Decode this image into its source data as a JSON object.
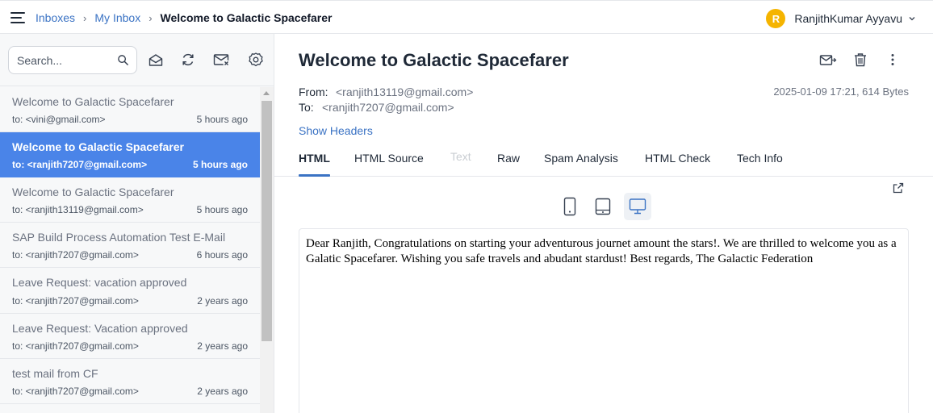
{
  "breadcrumb": {
    "items": [
      "Inboxes",
      "My Inbox"
    ],
    "current": "Welcome to Galactic Spacefarer"
  },
  "user": {
    "initial": "R",
    "name": "RanjithKumar Ayyavu",
    "avatar_color": "#f5b400"
  },
  "search": {
    "placeholder": "Search..."
  },
  "toolbar_icons": [
    "mark-read-icon",
    "refresh-icon",
    "clear-inbox-icon",
    "settings-icon"
  ],
  "messages": [
    {
      "subject": "Welcome to Galactic Spacefarer",
      "to": "to: <vini@gmail.com>",
      "time": "5 hours ago",
      "active": false
    },
    {
      "subject": "Welcome to Galactic Spacefarer",
      "to": "to: <ranjith7207@gmail.com>",
      "time": "5 hours ago",
      "active": true
    },
    {
      "subject": "Welcome to Galactic Spacefarer",
      "to": "to: <ranjith13119@gmail.com>",
      "time": "5 hours ago",
      "active": false
    },
    {
      "subject": "SAP Build Process Automation Test E-Mail",
      "to": "to: <ranjith7207@gmail.com>",
      "time": "6 hours ago",
      "active": false
    },
    {
      "subject": "Leave Request: vacation approved",
      "to": "to: <ranjith7207@gmail.com>",
      "time": "2 years ago",
      "active": false
    },
    {
      "subject": "Leave Request: Vacation approved",
      "to": "to: <ranjith7207@gmail.com>",
      "time": "2 years ago",
      "active": false
    },
    {
      "subject": "test mail from CF",
      "to": "to: <ranjith7207@gmail.com>",
      "time": "2 years ago",
      "active": false
    }
  ],
  "email": {
    "title": "Welcome to Galactic Spacefarer",
    "from_label": "From:",
    "from": "<ranjith13119@gmail.com>",
    "to_label": "To:",
    "to": "<ranjith7207@gmail.com>",
    "meta": "2025-01-09 17:21, 614 Bytes",
    "show_headers": "Show Headers",
    "body": "Dear Ranjith, Congratulations on starting your adventurous journet amount the stars!. We are thrilled to welcome you as a Galatic Spacefarer. Wishing you safe travels and abudant stardust! Best regards, The Galactic Federation"
  },
  "tabs": [
    {
      "label": "HTML",
      "state": "active"
    },
    {
      "label": "HTML Source",
      "state": "normal"
    },
    {
      "label": "Text",
      "state": "disabled"
    },
    {
      "label": "Raw",
      "state": "normal"
    },
    {
      "label": "Spam Analysis",
      "state": "normal"
    },
    {
      "label": "HTML Check",
      "state": "normal"
    },
    {
      "label": "Tech Info",
      "state": "normal"
    }
  ],
  "preview_devices": [
    "mobile-device-icon",
    "tablet-device-icon",
    "desktop-device-icon"
  ],
  "selected_device": "desktop",
  "colors": {
    "accent": "#3b73c4",
    "active_row": "#4a84e8"
  }
}
